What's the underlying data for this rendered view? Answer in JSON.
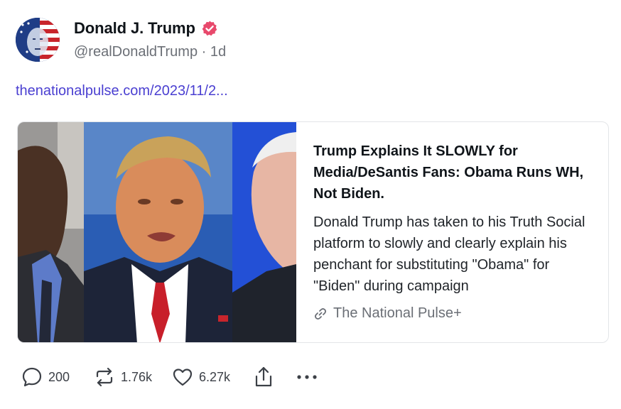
{
  "author": {
    "display_name": "Donald J. Trump",
    "handle": "@realDonaldTrump",
    "separator": "·",
    "time_ago": "1d"
  },
  "post": {
    "link_text": "thenationalpulse.com/2023/11/2..."
  },
  "card": {
    "title": "Trump Explains It SLOWLY for Media/DeSantis Fans: Obama Runs WH, Not Biden.",
    "description": "Donald Trump has taken to his Truth Social platform to slowly and clearly explain his penchant for substituting \"Obama\" for \"Biden\" during campaign",
    "source": "The National Pulse+"
  },
  "actions": {
    "replies": "200",
    "retruths": "1.76k",
    "likes": "6.27k"
  },
  "icons": {
    "verified": "verified-badge-icon",
    "link": "link-icon",
    "reply": "speech-bubble-icon",
    "retruth": "repost-arrows-icon",
    "like": "heart-icon",
    "share": "share-upload-icon",
    "more": "more-dots-icon"
  },
  "colors": {
    "verified_badge": "#e8496c",
    "link": "#4a3fd1",
    "muted_text": "#6b6f76"
  }
}
